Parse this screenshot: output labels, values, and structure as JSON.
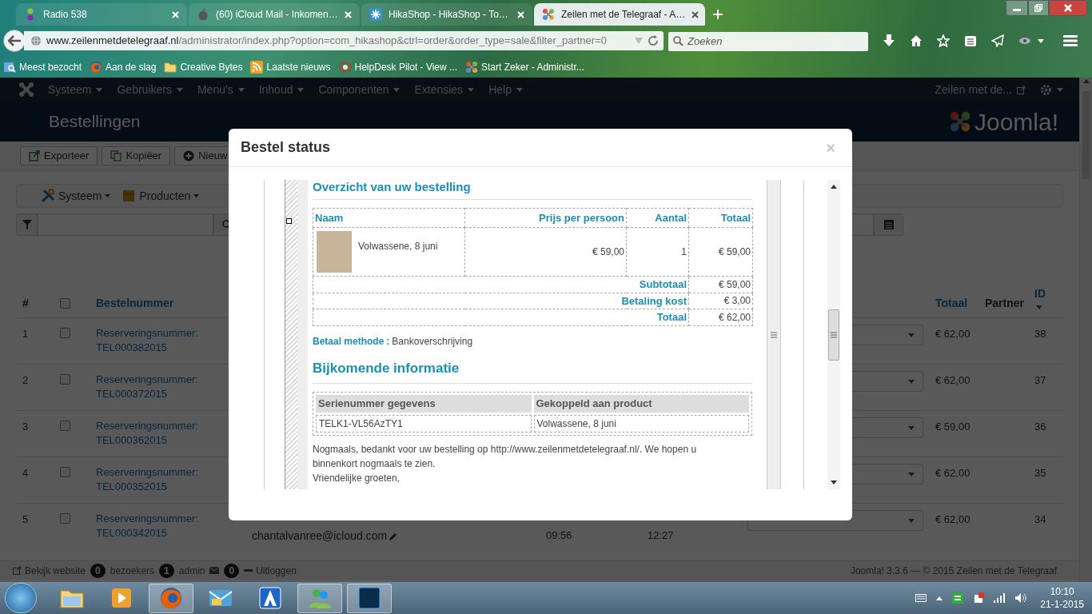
{
  "browser": {
    "tabs": [
      {
        "title": "Radio 538",
        "kind": "radio",
        "selected": false
      },
      {
        "title": "(60) iCloud Mail - Inkomen…",
        "kind": "apple",
        "selected": false
      },
      {
        "title": "HikaShop - HikaShop - To…",
        "kind": "hikashop",
        "selected": false
      },
      {
        "title": "Zeilen met de Telegraaf - A…",
        "kind": "joomla",
        "selected": true
      }
    ],
    "url_host": "www.zeilenmetdetelegraaf.nl",
    "url_path": "/administrator/index.php?option=com_hikashop&ctrl=order&order_type=sale&filter_partner=0",
    "search_placeholder": "Zoeken",
    "bookmarks": [
      {
        "label": "Meest bezocht",
        "kind": "smart"
      },
      {
        "label": "Aan de slag",
        "kind": "firefox"
      },
      {
        "label": "Creative Bytes",
        "kind": "folder"
      },
      {
        "label": "Laatste nieuws",
        "kind": "rss"
      },
      {
        "label": "HelpDesk Pilot - View ...",
        "kind": "gear"
      },
      {
        "label": "Start Zeker - Administr...",
        "kind": "joomla"
      }
    ]
  },
  "admin": {
    "menu": [
      "Systeem",
      "Gebruikers",
      "Menu's",
      "Inhoud",
      "Componenten",
      "Extensies",
      "Help"
    ],
    "user_menu": "Zeilen met de...",
    "page_title": "Bestellingen",
    "logo": "Joomla!",
    "toolbar": [
      {
        "label": "Exporteer",
        "kind": "export"
      },
      {
        "label": "Kopiëer",
        "kind": "copy"
      },
      {
        "label": "Nieuw",
        "kind": "new"
      }
    ],
    "submenu": [
      {
        "label": "Systeem",
        "kind": "tools"
      },
      {
        "label": "Producten",
        "kind": "box"
      }
    ],
    "table": {
      "header": {
        "number": "#",
        "checked": false,
        "order": "Bestelnummer",
        "total": "Totaal",
        "partner": "Partner",
        "id": "ID"
      },
      "rows": [
        {
          "number": "1",
          "checked": false,
          "order_label": "Reserveringsnummer:",
          "order_number": "TEL000382015",
          "total": "€ 62,00",
          "id": "38"
        },
        {
          "number": "2",
          "checked": false,
          "order_label": "Reserveringsnummer:",
          "order_number": "TEL000372015",
          "total": "€ 62,00",
          "id": "37"
        },
        {
          "number": "3",
          "checked": false,
          "order_label": "Reserveringsnummer:",
          "order_number": "TEL000362015",
          "total": "€ 59,00",
          "id": "36"
        },
        {
          "number": "4",
          "checked": false,
          "order_label": "Reserveringsnummer:",
          "order_number": "TEL000352015",
          "total": "€ 62,00",
          "id": "35"
        },
        {
          "number": "5",
          "checked": false,
          "order_label": "Reserveringsnummer:",
          "order_number": "TEL000342015",
          "customer": "chantalvanree@icloud.com",
          "time_1": "09:56",
          "time_2": "12:27",
          "total": "€ 62,00",
          "id": "34"
        }
      ]
    },
    "footer": {
      "view_site": "Bekijk website",
      "visitors_count": "0",
      "visitors": "bezoekers",
      "admins_count": "1",
      "admins": "admin",
      "messages_count": "0",
      "logout": "Uitloggen",
      "copyright": "Joomla! 3.3.6 — © 2015 Zeilen met de Telegraaf"
    }
  },
  "modal": {
    "title": "Bestel status",
    "close": "×",
    "heading": "Overzicht van uw bestelling",
    "order_columns": [
      "Naam",
      "Prijs per persoon",
      "Aantal",
      "Totaal"
    ],
    "items": [
      {
        "name": "Volwassene, 8 juni",
        "price": "€ 59,00",
        "quantity": "1",
        "total": "€ 59,00"
      }
    ],
    "summary": [
      {
        "label": "Subtotaal",
        "value": "€ 59,00"
      },
      {
        "label": "Betaling kost",
        "value": "€ 3,00"
      },
      {
        "label": "Totaal",
        "value": "€ 62,00"
      }
    ],
    "payment_label": "Betaal methode",
    "payment_separator": ":",
    "payment_value": "Bankoverschrijving",
    "info_heading": "Bijkomende informatie",
    "serial_columns": [
      "Serienummer gegevens",
      "Gekoppeld aan product"
    ],
    "serial_rows": [
      [
        "TELK1-VL56AzTY1",
        "Volwassene, 8 juni"
      ]
    ],
    "closing": [
      "Nogmaals, bedankt voor uw bestelling op http://www.zeilenmetdetelegraaf.nl/. We hopen u binnenkort nogmaals te zien.",
      "Vriendelijke groeten,"
    ]
  },
  "taskbar": {
    "apps": [
      {
        "kind": "explorer",
        "open": false
      },
      {
        "kind": "media",
        "open": false
      },
      {
        "kind": "firefox",
        "open": true
      },
      {
        "kind": "mail",
        "open": false
      },
      {
        "kind": "arrow",
        "open": false
      },
      {
        "kind": "people",
        "open": true
      },
      {
        "kind": "photoshop",
        "open": true
      }
    ],
    "time": "10:10",
    "date": "21-1-2015"
  }
}
